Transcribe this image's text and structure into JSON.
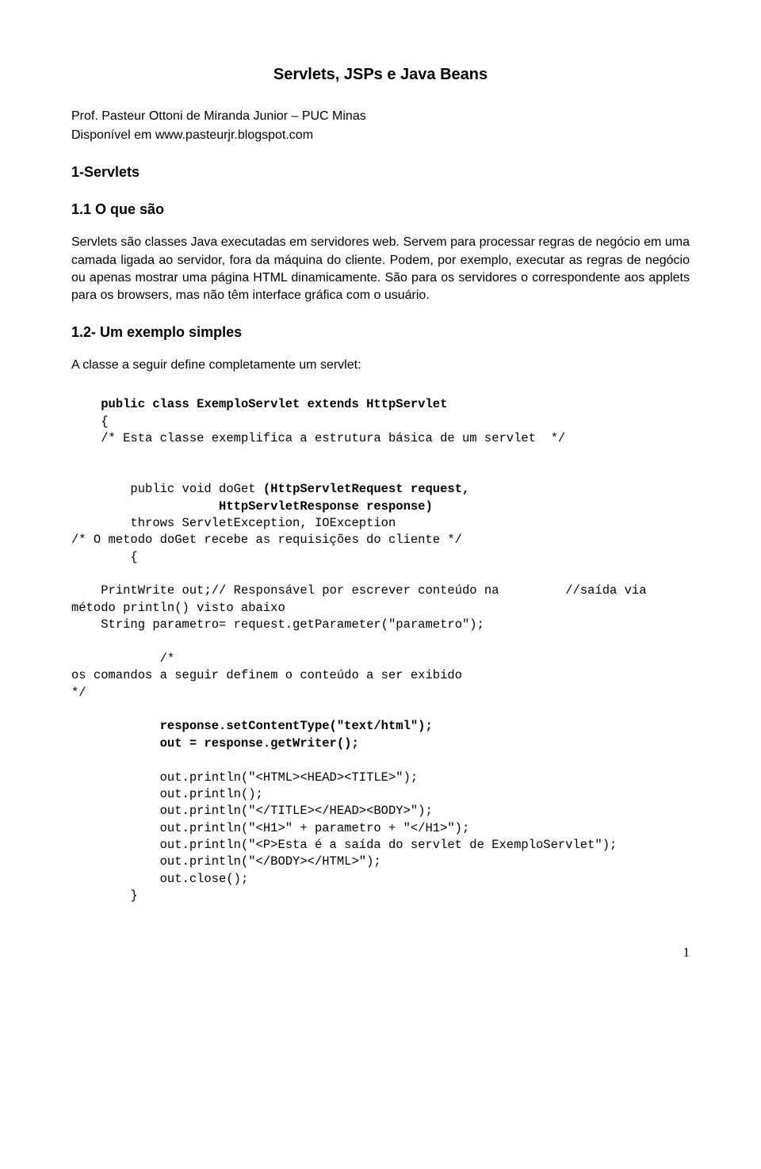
{
  "title": "Servlets, JSPs e Java Beans",
  "author_line": "Prof. Pasteur Ottoni de Miranda Junior – PUC Minas",
  "avail_line": "Disponível em www.pasteurjr.blogspot.com",
  "h_servlets": "1-Servlets",
  "h_oque": "1.1 O que são",
  "para_oque": "Servlets são classes Java executadas em  servidores web. Servem para processar regras de negócio em uma camada ligada ao servidor, fora da máquina do cliente. Podem, por exemplo, executar as regras de negócio ou apenas mostrar uma página HTML dinamicamente. São para os servidores o correspondente aos applets para os browsers, mas não têm interface gráfica com o usuário.",
  "h_exemplo": "1.2- Um exemplo simples",
  "intro_exemplo": "A classe a seguir define completamente um servlet:",
  "code": {
    "l01": "    public class ExemploServlet extends HttpServlet",
    "l02": "    {",
    "l03": "    /* Esta classe exemplifica a estrutura básica de um servlet  */",
    "l04": "",
    "l05": "",
    "l06a": "        public void doGet ",
    "l06b": "(HttpServletRequest request,",
    "l07": "                    HttpServletResponse response)",
    "l08": "        throws ServletException, IOException",
    "l09": "/* O metodo doGet recebe as requisições do cliente */",
    "l10": "        {",
    "l11": "",
    "l12": "    PrintWrite out;// Responsável por escrever conteúdo na         //saída via método println() visto abaixo",
    "l13": "    String parametro= request.getParameter(\"parametro\");",
    "l14": "",
    "l15": "            /*",
    "l16": "os comandos a seguir definem o conteúdo a ser exibido",
    "l17": "*/",
    "l18": "",
    "l19": "            response.setContentType(\"text/html\");",
    "l20": "            out = response.getWriter();",
    "l21": "",
    "l22": "            out.println(\"<HTML><HEAD><TITLE>\");",
    "l23": "            out.println();",
    "l24": "            out.println(\"</TITLE></HEAD><BODY>\");",
    "l25": "            out.println(\"<H1>\" + parametro + \"</H1>\");",
    "l26": "            out.println(\"<P>Esta é a saída do servlet de ExemploServlet\");",
    "l27": "            out.println(\"</BODY></HTML>\");",
    "l28": "            out.close();",
    "l29": "        }"
  },
  "pagenum": "1"
}
